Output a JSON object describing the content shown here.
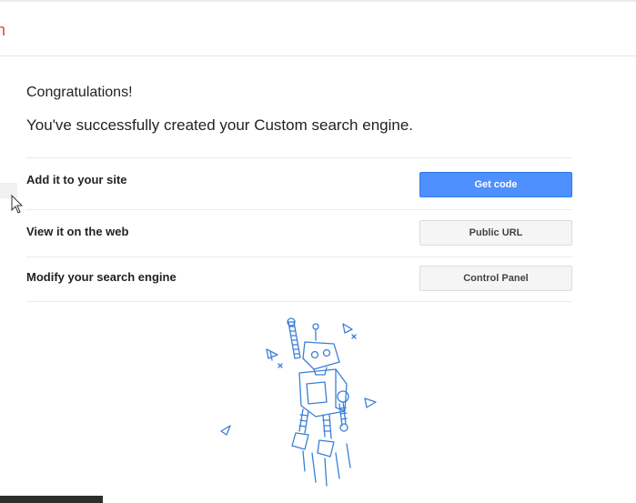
{
  "header": {
    "logo_fragment": "n"
  },
  "main": {
    "congrats": "Congratulations!",
    "success_message": "You've successfully created your Custom search engine."
  },
  "actions": [
    {
      "label": "Add it to your site",
      "button": "Get code"
    },
    {
      "label": "View it on the web",
      "button": "Public URL"
    },
    {
      "label": "Modify your search engine",
      "button": "Control Panel"
    }
  ],
  "colors": {
    "primary": "#4d90fe",
    "logo_red": "#dd4b39",
    "robot_blue": "#3b7fd6"
  },
  "icons": [
    "mouse-cursor-icon",
    "robot-illustration"
  ]
}
